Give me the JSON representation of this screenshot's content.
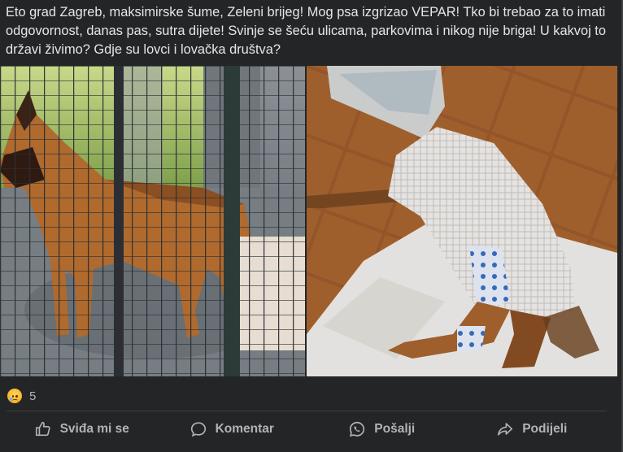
{
  "post": {
    "text": "Eto grad Zagreb, maksimirske šume, Zeleni brijeg! Mog psa izgrizao VEPAR! Tko bi trebao za to imati odgovornost, danas pas, sutra dijete! Svinje se šeću ulicama, parkovima i nikog nije briga! U kakvoj to državi živimo? Gdje su lovci i lovačka društva?"
  },
  "reactions": {
    "icon": "sad-face-emoji",
    "count": "5"
  },
  "actions": {
    "like_label": "Sviđa mi se",
    "comment_label": "Komentar",
    "send_label": "Pošalji",
    "share_label": "Podijeli"
  },
  "colors": {
    "background": "#242526",
    "text": "#e4e6eb",
    "secondary_text": "#b0b3b8",
    "divider": "#3e4042"
  }
}
